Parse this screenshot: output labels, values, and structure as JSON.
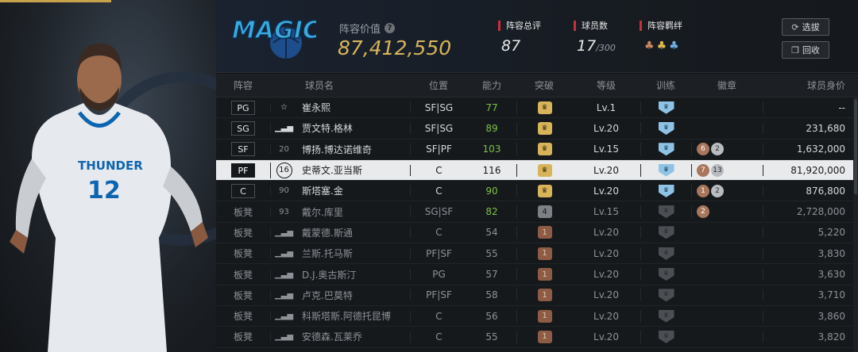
{
  "header": {
    "team_logo_text": "MAGIC",
    "value_label": "阵容价值",
    "value": "87,412,550",
    "overall_label": "阵容总评",
    "overall": "87",
    "players_label": "球员数",
    "players_count": "17",
    "players_max": "/300",
    "chem_label": "阵容羁绊",
    "select_button": "选拔",
    "recycle_button": "回收"
  },
  "colors": {
    "gold": "#d7b45a",
    "accent_red": "#c8303a",
    "green": "#7cc14a",
    "shield_blue": "#8fc3e6"
  },
  "table": {
    "headers": [
      "阵容",
      "球员名",
      "位置",
      "能力",
      "突破",
      "等级",
      "训练",
      "徽章",
      "球员身价"
    ],
    "rows": [
      {
        "slot": "PG",
        "num": "",
        "name": "崔永熙",
        "pos": "SF|SG",
        "ovr": "77",
        "ovr_green": true,
        "brk": "gold",
        "lv": "Lv.1",
        "train": "blue",
        "badges": [],
        "salary": "--"
      },
      {
        "slot": "SG",
        "num": "",
        "name": "贾文特.格林",
        "pos": "SF|SG",
        "ovr": "89",
        "ovr_green": true,
        "brk": "gold",
        "lv": "Lv.20",
        "train": "blue",
        "badges": [],
        "salary": "231,680"
      },
      {
        "slot": "SF",
        "num": "20",
        "name": "博扬.博达诺维奇",
        "pos": "SF|PF",
        "ovr": "103",
        "ovr_green": true,
        "brk": "gold",
        "lv": "Lv.15",
        "train": "blue",
        "badges": [
          {
            "t": "6",
            "k": "b"
          },
          {
            "t": "2",
            "k": "s"
          }
        ],
        "salary": "1,632,000"
      },
      {
        "slot": "PF",
        "num": "16",
        "name": "史蒂文.亚当斯",
        "pos": "C",
        "ovr": "116",
        "ovr_green": false,
        "brk": "gold",
        "lv": "Lv.20",
        "train": "blue",
        "badges": [
          {
            "t": "7",
            "k": "b"
          },
          {
            "t": "13",
            "k": "s"
          }
        ],
        "salary": "81,920,000",
        "selected": true
      },
      {
        "slot": "C",
        "num": "90",
        "name": "斯塔塞.金",
        "pos": "C",
        "ovr": "90",
        "ovr_green": true,
        "brk": "gold",
        "lv": "Lv.20",
        "train": "blue",
        "badges": [
          {
            "t": "1",
            "k": "b"
          },
          {
            "t": "2",
            "k": "s"
          }
        ],
        "salary": "876,800"
      },
      {
        "slot": "板凳",
        "num": "93",
        "name": "戴尔.库里",
        "pos": "SG|SF",
        "ovr": "82",
        "ovr_green": true,
        "brk": "grey4",
        "lv": "Lv.15",
        "train": "dark",
        "badges": [
          {
            "t": "2",
            "k": "b"
          }
        ],
        "salary": "2,728,000"
      },
      {
        "slot": "板凳",
        "num": "",
        "name": "戴蒙德.斯通",
        "pos": "C",
        "ovr": "54",
        "ovr_green": false,
        "brk": "bronze",
        "lv": "Lv.20",
        "train": "dark",
        "badges": [],
        "salary": "5,220"
      },
      {
        "slot": "板凳",
        "num": "",
        "name": "兰斯.托马斯",
        "pos": "PF|SF",
        "ovr": "55",
        "ovr_green": false,
        "brk": "bronze",
        "lv": "Lv.20",
        "train": "dark",
        "badges": [],
        "salary": "3,830"
      },
      {
        "slot": "板凳",
        "num": "",
        "name": "D.J.奥古斯汀",
        "pos": "PG",
        "ovr": "57",
        "ovr_green": false,
        "brk": "bronze",
        "lv": "Lv.20",
        "train": "dark",
        "badges": [],
        "salary": "3,630"
      },
      {
        "slot": "板凳",
        "num": "",
        "name": "卢克.巴莫特",
        "pos": "PF|SF",
        "ovr": "58",
        "ovr_green": false,
        "brk": "bronze",
        "lv": "Lv.20",
        "train": "dark",
        "badges": [],
        "salary": "3,710"
      },
      {
        "slot": "板凳",
        "num": "",
        "name": "科斯塔斯.阿德托昆博",
        "pos": "C",
        "ovr": "56",
        "ovr_green": false,
        "brk": "bronze",
        "lv": "Lv.20",
        "train": "dark",
        "badges": [],
        "salary": "3,860"
      },
      {
        "slot": "板凳",
        "num": "",
        "name": "安德森.瓦莱乔",
        "pos": "C",
        "ovr": "55",
        "ovr_green": false,
        "brk": "bronze",
        "lv": "Lv.20",
        "train": "dark",
        "badges": [],
        "salary": "3,820"
      }
    ]
  },
  "hero": {
    "jersey_text": "THUNDER",
    "jersey_number": "12"
  }
}
